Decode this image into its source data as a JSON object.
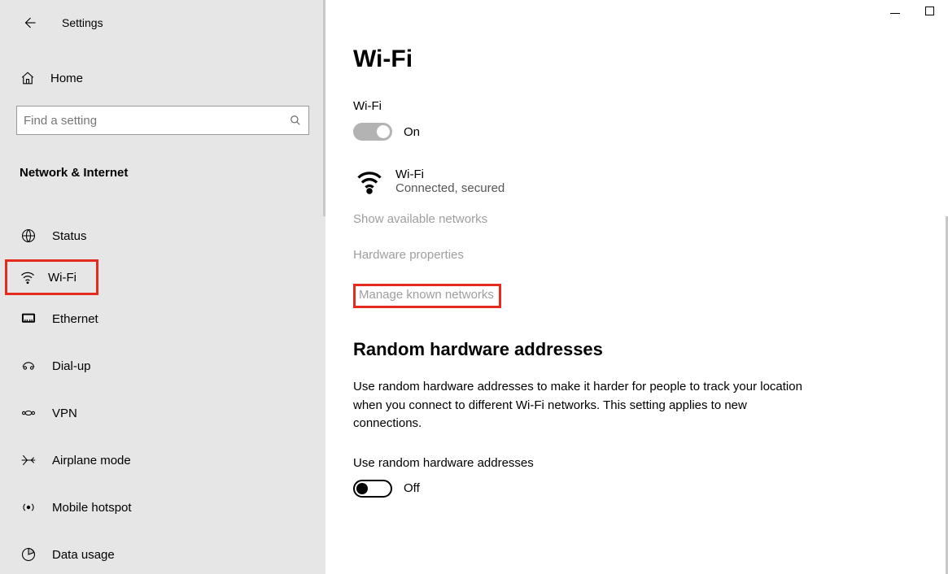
{
  "app_title": "Settings",
  "sidebar": {
    "home_label": "Home",
    "search_placeholder": "Find a setting",
    "section_title": "Network & Internet",
    "items": [
      {
        "label": "Status"
      },
      {
        "label": "Wi-Fi"
      },
      {
        "label": "Ethernet"
      },
      {
        "label": "Dial-up"
      },
      {
        "label": "VPN"
      },
      {
        "label": "Airplane mode"
      },
      {
        "label": "Mobile hotspot"
      },
      {
        "label": "Data usage"
      }
    ]
  },
  "main": {
    "page_title": "Wi-Fi",
    "wifi_label": "Wi-Fi",
    "wifi_toggle_state": "On",
    "wifi_network_name": "Wi-Fi",
    "wifi_network_status": "Connected, secured",
    "link_show_available": "Show available networks",
    "link_hardware_properties": "Hardware properties",
    "link_manage_known": "Manage known networks",
    "random_heading": "Random hardware addresses",
    "random_desc": "Use random hardware addresses to make it harder for people to track your location when you connect to different Wi-Fi networks. This setting applies to new connections.",
    "random_toggle_label": "Use random hardware addresses",
    "random_toggle_state": "Off"
  }
}
